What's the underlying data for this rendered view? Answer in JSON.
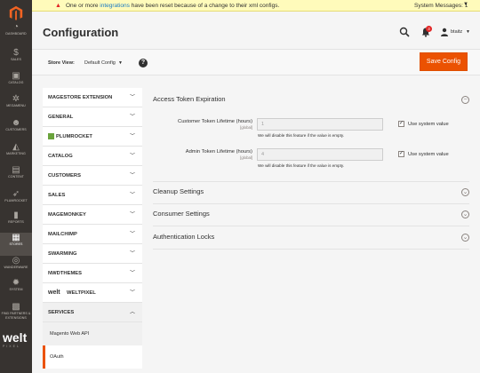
{
  "system_message": {
    "text_before": "One or more ",
    "link": "integrations",
    "text_after": " have been reset because of a change to their xml configs.",
    "counter": "System Messages: 1"
  },
  "admin_nav": {
    "items": [
      {
        "label": "Dashboard",
        "icon": "speedometer-icon",
        "glyph": "◔"
      },
      {
        "label": "Sales",
        "icon": "dollar-icon",
        "glyph": "$"
      },
      {
        "label": "Catalog",
        "icon": "box-icon",
        "glyph": "▣"
      },
      {
        "label": "Megamenu",
        "icon": "gear-icon",
        "glyph": "✲"
      },
      {
        "label": "Customers",
        "icon": "person-icon",
        "glyph": "☻"
      },
      {
        "label": "Marketing",
        "icon": "megaphone-icon",
        "glyph": "◭"
      },
      {
        "label": "Content",
        "icon": "content-icon",
        "glyph": "▤"
      },
      {
        "label": "Plumrocket",
        "icon": "rocket-icon",
        "glyph": "➶"
      },
      {
        "label": "Reports",
        "icon": "bar-chart-icon",
        "glyph": "▮"
      },
      {
        "label": "Stores",
        "icon": "store-icon",
        "glyph": "▦"
      },
      {
        "label": "Wanderware",
        "icon": "target-icon",
        "glyph": "◎"
      },
      {
        "label": "System",
        "icon": "gear-icon",
        "glyph": "✹"
      },
      {
        "label": "Find Partners & Extensions",
        "icon": "puzzle-icon",
        "glyph": "▩"
      }
    ],
    "brand": "welt",
    "brand_sub": "PIXEL"
  },
  "header": {
    "title": "Configuration",
    "notifications_count": "3",
    "user": "btaitz"
  },
  "scope": {
    "label": "Store View:",
    "value": "Default Config",
    "help": "?",
    "save_label": "Save Config"
  },
  "tabs": [
    {
      "label": "MAGESTORE EXTENSION",
      "brand": ""
    },
    {
      "label": "GENERAL",
      "brand": ""
    },
    {
      "label": "PLUMROCKET",
      "brand": "plumrocket"
    },
    {
      "label": "CATALOG",
      "brand": ""
    },
    {
      "label": "CUSTOMERS",
      "brand": ""
    },
    {
      "label": "SALES",
      "brand": ""
    },
    {
      "label": "MAGEMONKEY",
      "brand": ""
    },
    {
      "label": "MAILCHIMP",
      "brand": ""
    },
    {
      "label": "SWARMING",
      "brand": ""
    },
    {
      "label": "NWDTHEMES",
      "brand": ""
    },
    {
      "label": "WELTPIXEL",
      "brand": "welt"
    }
  ],
  "services": {
    "label": "SERVICES",
    "items": [
      {
        "label": "Magento Web API"
      },
      {
        "label": "OAuth"
      }
    ]
  },
  "sections": {
    "access_token": {
      "title": "Access Token Expiration",
      "customer": {
        "label": "Customer Token Lifetime (hours)",
        "scope": "[global]",
        "value": "1",
        "note": "We will disable this feature if the value is empty.",
        "use_system": "Use system value"
      },
      "admin": {
        "label": "Admin Token Lifetime (hours)",
        "scope": "[global]",
        "value": "4",
        "note": "We will disable this feature if the value is empty.",
        "use_system": "Use system value"
      }
    },
    "cleanup": {
      "title": "Cleanup Settings"
    },
    "consumer": {
      "title": "Consumer Settings"
    },
    "auth_locks": {
      "title": "Authentication Locks"
    }
  }
}
